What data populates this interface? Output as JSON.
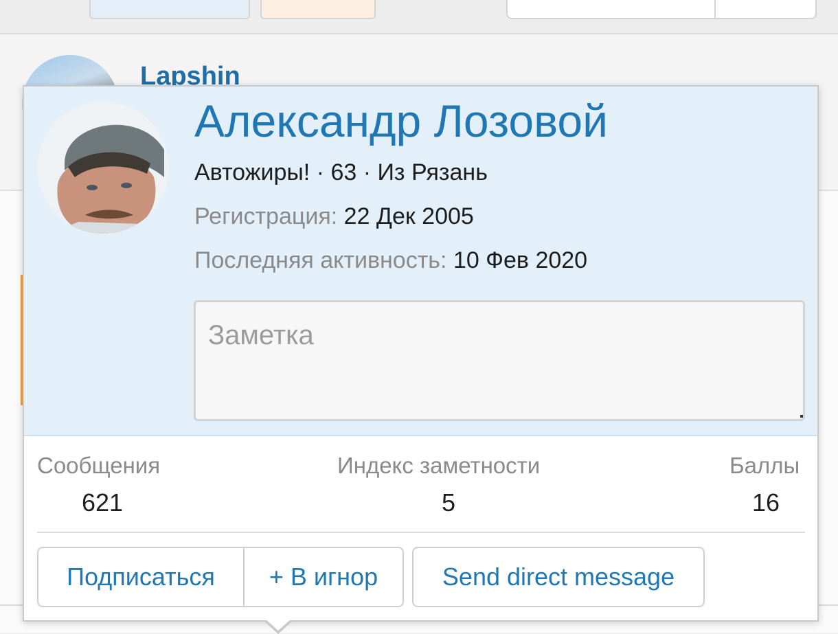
{
  "background": {
    "author_name": "Lapshin"
  },
  "profile": {
    "name": "Александр Лозовой",
    "title_line": "Автожиры! · 63 · Из Рязань",
    "registration_label": "Регистрация:",
    "registration_value": "22 Дек 2005",
    "last_activity_label": "Последняя активность:",
    "last_activity_value": "10 Фев 2020",
    "avatar_icon": "user-photo"
  },
  "note": {
    "placeholder": "Заметка",
    "value": ""
  },
  "stats": {
    "posts_label": "Сообщения",
    "posts_value": "621",
    "index_label": "Индекс заметности",
    "index_value": "5",
    "points_label": "Баллы",
    "points_value": "16"
  },
  "actions": {
    "follow_label": "Подписаться",
    "ignore_label": "+ В игнор",
    "message_label": "Send direct message"
  },
  "colors": {
    "accent": "#1f78b4",
    "header_bg": "#e3f0fa",
    "muted_text": "#8a8a8a"
  }
}
